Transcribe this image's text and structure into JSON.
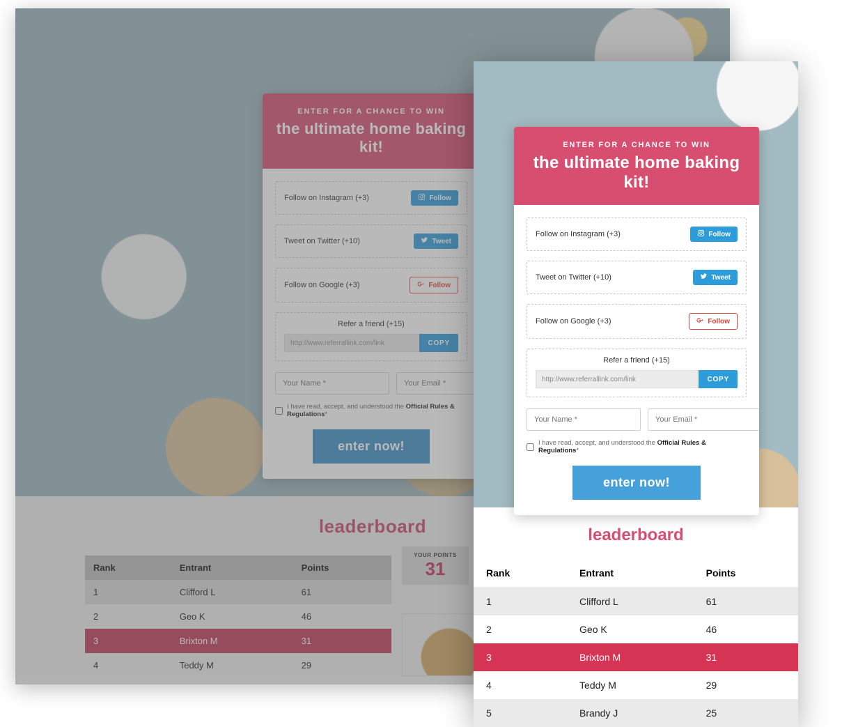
{
  "colors": {
    "accent": "#d84e70",
    "primary_blue": "#2d9cdb",
    "highlight_row": "#d53455"
  },
  "card": {
    "eyebrow": "ENTER FOR A CHANCE TO WIN",
    "title": "the ultimate home baking kit!",
    "actions": {
      "instagram": {
        "label": "Follow on Instagram (+3)",
        "btn": "Follow"
      },
      "twitter": {
        "label": "Tweet on Twitter (+10)",
        "btn": "Tweet"
      },
      "google": {
        "label": "Follow on Google (+3)",
        "btn": "Follow"
      }
    },
    "refer": {
      "title": "Refer a friend (+15)",
      "link": "http://www.referrallink.com/link",
      "copy": "COPY"
    },
    "fields": {
      "name_placeholder": "Your Name *",
      "email_placeholder": "Your Email *"
    },
    "consent": {
      "prefix": "I have read, accept, and understood the",
      "bold": "Official Rules & Regulations",
      "suffix": "*"
    },
    "submit": "enter now!"
  },
  "leaderboard": {
    "title": "leaderboard",
    "columns": {
      "rank": "Rank",
      "entrant": "Entrant",
      "points": "Points"
    },
    "your_points_label": "YOUR POINTS",
    "your_points_value": "31",
    "rows_back": [
      {
        "rank": "1",
        "entrant": "Clifford L",
        "points": "61",
        "hl": false
      },
      {
        "rank": "2",
        "entrant": "Geo K",
        "points": "46",
        "hl": false
      },
      {
        "rank": "3",
        "entrant": "Brixton M",
        "points": "31",
        "hl": true
      },
      {
        "rank": "4",
        "entrant": "Teddy M",
        "points": "29",
        "hl": false
      }
    ],
    "rows_front": [
      {
        "rank": "1",
        "entrant": "Clifford L",
        "points": "61",
        "hl": false
      },
      {
        "rank": "2",
        "entrant": "Geo K",
        "points": "46",
        "hl": false
      },
      {
        "rank": "3",
        "entrant": "Brixton M",
        "points": "31",
        "hl": true
      },
      {
        "rank": "4",
        "entrant": "Teddy M",
        "points": "29",
        "hl": false
      },
      {
        "rank": "5",
        "entrant": "Brandy J",
        "points": "25",
        "hl": false
      }
    ]
  }
}
